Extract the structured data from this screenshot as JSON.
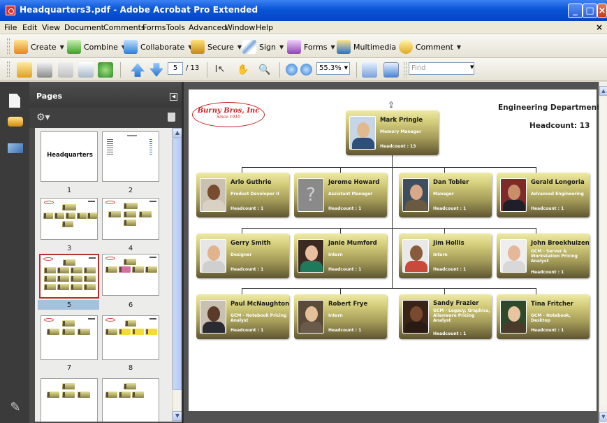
{
  "window": {
    "title": "Headquarters3.pdf - Adobe Acrobat Pro Extended"
  },
  "menu": [
    "File",
    "Edit",
    "View",
    "Document",
    "Comments",
    "Forms",
    "Tools",
    "Advanced",
    "Window",
    "Help"
  ],
  "toolbar1": {
    "create": "Create",
    "combine": "Combine",
    "collaborate": "Collaborate",
    "secure": "Secure",
    "sign": "Sign",
    "forms": "Forms",
    "multimedia": "Multimedia",
    "comment": "Comment"
  },
  "toolbar2": {
    "page_current": "5",
    "page_total": "/ 13",
    "zoom": "55.3%",
    "find_placeholder": "Find"
  },
  "pages_panel": {
    "title": "Pages",
    "thumbnails": [
      {
        "num": "1",
        "title": "Headquarters"
      },
      {
        "num": "2"
      },
      {
        "num": "3"
      },
      {
        "num": "4"
      },
      {
        "num": "5"
      },
      {
        "num": "6"
      },
      {
        "num": "7"
      },
      {
        "num": "8"
      }
    ]
  },
  "document": {
    "logo": {
      "name": "Burny Bros, Inc",
      "tagline": "Since 1910"
    },
    "department": "Engineering Department",
    "headcount": "Headcount:  13",
    "manager": {
      "name": "Mark Pringle",
      "role": "Memory Manager",
      "headcount": "Headcount : 13"
    },
    "rows": [
      [
        {
          "name": "Arlo Guthrie",
          "role": "Product Developer II",
          "headcount": "Headcount : 1"
        },
        {
          "name": "Jerome Howard",
          "role": "Assistant Manager",
          "headcount": "Headcount : 1"
        },
        {
          "name": "Dan Tobler",
          "role": "Manager",
          "headcount": "Headcount : 1"
        },
        {
          "name": "Gerald Longoria",
          "role": "Advanced Engineering",
          "headcount": "Headcount : 1"
        }
      ],
      [
        {
          "name": "Gerry Smith",
          "role": "Designer",
          "headcount": "Headcount : 1"
        },
        {
          "name": "Janie Mumford",
          "role": "Intern",
          "headcount": "Headcount : 1"
        },
        {
          "name": "Jim Hollis",
          "role": "Intern",
          "headcount": "Headcount : 1"
        },
        {
          "name": "John Broekhuizen",
          "role": "GCM - Server & Workstation Pricing Analyst",
          "headcount": "Headcount : 1"
        }
      ],
      [
        {
          "name": "Paul McNaughton",
          "role": "GCM - Notebook Pricing Analyst",
          "headcount": "Headcount : 1"
        },
        {
          "name": "Robert Frye",
          "role": "Intern",
          "headcount": "Headcount : 1"
        },
        {
          "name": "Sandy Frazier",
          "role": "GCM - Legacy, Graphics, Alienware Pricing Analyst",
          "headcount": "Headcount : 1"
        },
        {
          "name": "Tina Fritcher",
          "role": "GCM - Notebook, Desktop",
          "headcount": "Headcount : 1"
        }
      ]
    ]
  },
  "colors": {
    "title_bar": "#0a55d8",
    "card_top": "#eeeaa4",
    "card_bottom": "#5f5531",
    "panel_bg": "#4b4b4b",
    "selection_red": "#c02b2b"
  },
  "icons": [
    "app-pdf-icon",
    "pages-icon",
    "comments-icon",
    "signature-icon",
    "attachment-icon",
    "options-gear-icon",
    "trash-icon"
  ]
}
